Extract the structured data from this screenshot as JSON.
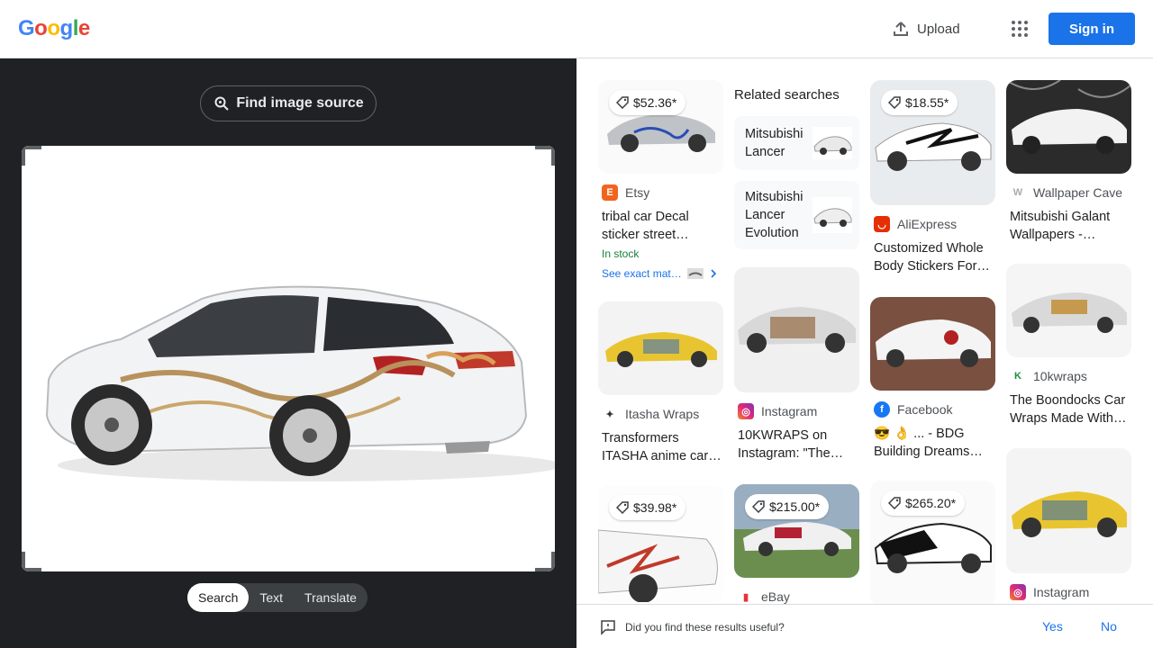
{
  "header": {
    "logo_letters": [
      "G",
      "o",
      "o",
      "g",
      "l",
      "e"
    ],
    "upload_label": "Upload",
    "apps_icon": "apps-grid-icon",
    "signin_label": "Sign in"
  },
  "left": {
    "find_source_label": "Find image source",
    "tabs": [
      {
        "label": "Search",
        "active": true
      },
      {
        "label": "Text",
        "active": false
      },
      {
        "label": "Translate",
        "active": false
      }
    ]
  },
  "results": {
    "col1": [
      {
        "price": "$52.36*",
        "source": "Etsy",
        "title": "tribal car Decal sticker street…",
        "stock": "In stock",
        "exact": "See exact mat…"
      },
      {
        "source": "Itasha Wraps",
        "title": "Transformers ITASHA anime car…"
      },
      {
        "price": "$39.98*"
      }
    ],
    "related_title": "Related searches",
    "related": [
      {
        "label1": "Mitsubishi",
        "label2": "Lancer"
      },
      {
        "label1": "Mitsubishi",
        "label2": "Lancer",
        "label3": "Evolution"
      }
    ],
    "col2": [
      {
        "source": "Instagram",
        "title": "10KWRAPS on Instagram: \"The…"
      },
      {
        "price": "$215.00*",
        "source": "eBay"
      }
    ],
    "col3": [
      {
        "price": "$18.55*",
        "source": "AliExpress",
        "title": "Customized Whole Body Stickers For…"
      },
      {
        "source": "Facebook",
        "title": "😎 👌 ... - BDG Building Dreams…"
      },
      {
        "price": "$265.20*"
      }
    ],
    "col4": [
      {
        "source": "Wallpaper Cave",
        "title": "Mitsubishi Galant Wallpapers -…"
      },
      {
        "source": "10kwraps",
        "title": "The Boondocks Car Wraps Made With…"
      },
      {
        "source": "Instagram"
      }
    ]
  },
  "feedback": {
    "question": "Did you find these results useful?",
    "yes": "Yes",
    "no": "No"
  },
  "colors": {
    "accent": "#1a73e8",
    "dark_panel": "#202124"
  }
}
